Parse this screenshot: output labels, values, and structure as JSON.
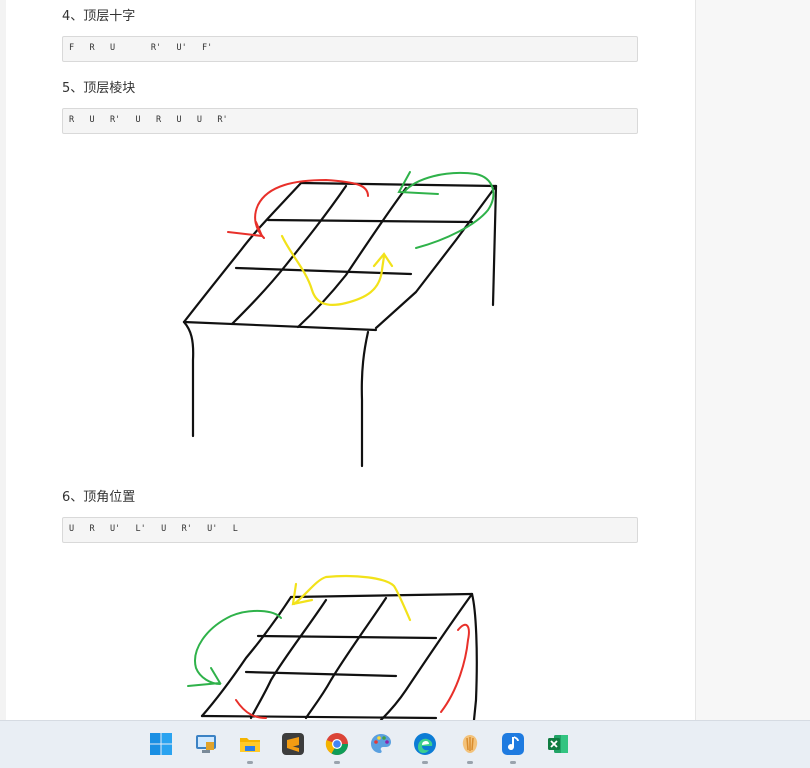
{
  "document": {
    "sections": [
      {
        "heading": "4、顶层十字",
        "code": "F   R   U       R'   U'   F'"
      },
      {
        "heading": "5、顶层棱块",
        "code": "R   U   R'   U   R   U   U   R'"
      },
      {
        "heading": "6、顶角位置",
        "code": "U   R   U'   L'   U   R'   U'   L"
      }
    ]
  },
  "taskbar": {
    "apps": [
      {
        "name": "start",
        "icon": "windows-start-icon"
      },
      {
        "name": "remote-desktop",
        "icon": "remote-desktop-icon"
      },
      {
        "name": "file-explorer",
        "icon": "folder-icon"
      },
      {
        "name": "sublime-text",
        "icon": "sublime-text-icon"
      },
      {
        "name": "chrome",
        "icon": "chrome-icon"
      },
      {
        "name": "paint",
        "icon": "palette-icon"
      },
      {
        "name": "edge",
        "icon": "edge-icon"
      },
      {
        "name": "app-orange",
        "icon": "shell-icon"
      },
      {
        "name": "app-blue-music",
        "icon": "music-note-icon"
      },
      {
        "name": "excel",
        "icon": "excel-icon"
      }
    ]
  },
  "colors": {
    "sketch_black": "#111111",
    "sketch_red": "#e8302a",
    "sketch_green": "#2fb24a",
    "sketch_yellow": "#f2e21a"
  }
}
